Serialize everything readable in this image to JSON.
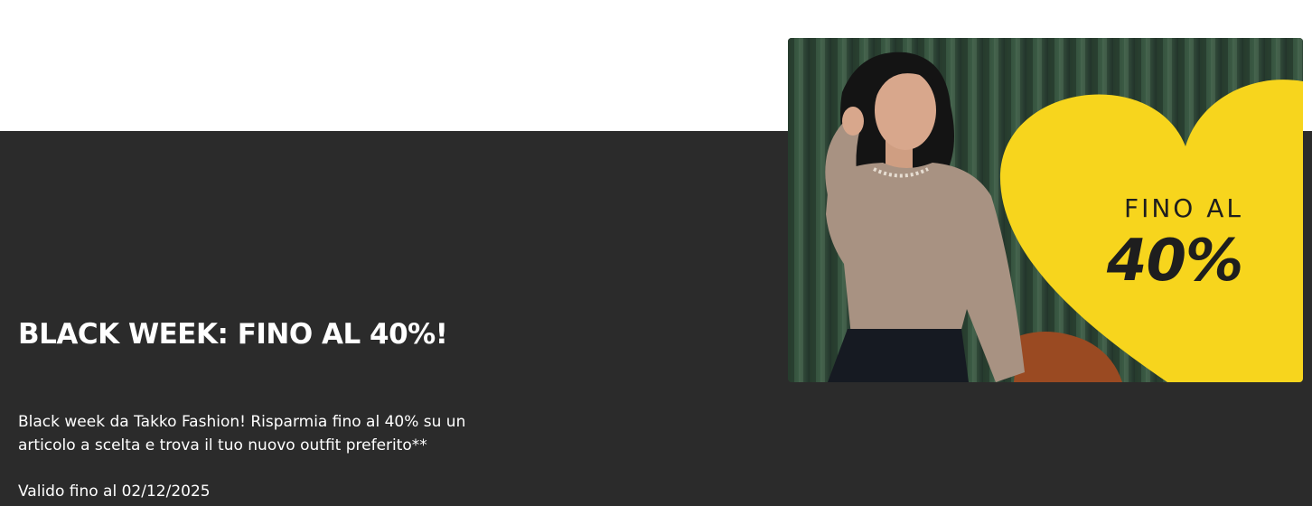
{
  "promo": {
    "headline": "BLACK WEEK: FINO AL 40%!",
    "description": "Black week da Takko Fashion! Risparmia fino al 40% su un articolo a scelta e trova il tuo nuovo outfit preferito**",
    "validity": "Valido fino al 02/12/2025"
  },
  "promo_image": {
    "badge_line1": "FINO AL",
    "badge_line2": "40%",
    "badge_shape": "heart",
    "badge_color": "#f7d51d"
  },
  "colors": {
    "panel_background": "#2b2b2b",
    "text": "#ffffff"
  }
}
